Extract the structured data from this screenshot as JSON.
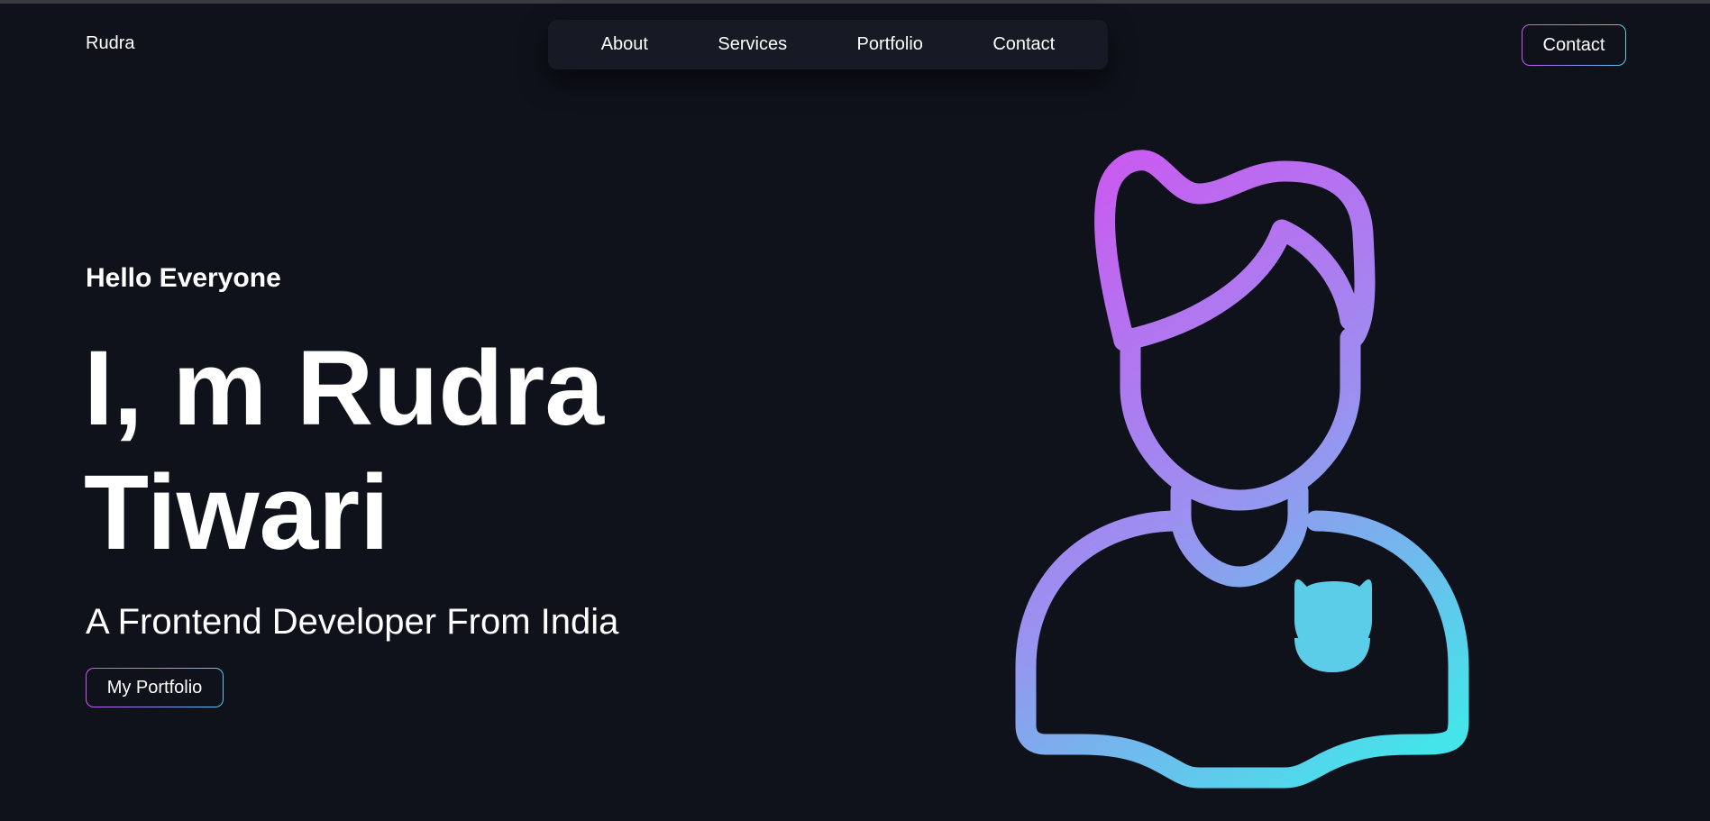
{
  "header": {
    "brand": "Rudra",
    "nav": [
      "About",
      "Services",
      "Portfolio",
      "Contact"
    ],
    "cta_label": "Contact"
  },
  "hero": {
    "greeting": "Hello Everyone",
    "name_line1": "I, m Rudra",
    "name_line2": "Tiwari",
    "tagline": "A Frontend Developer From India",
    "button_label": "My Portfolio"
  },
  "illustration": {
    "icon": "user-avatar-icon",
    "gradient_colors": [
      "#c95bf0",
      "#9c8ff0",
      "#45e3ea"
    ]
  },
  "colors": {
    "background": "#0f121b",
    "nav_background": "#161a24",
    "accent_start": "#c459ee",
    "accent_end": "#58c9ec"
  }
}
